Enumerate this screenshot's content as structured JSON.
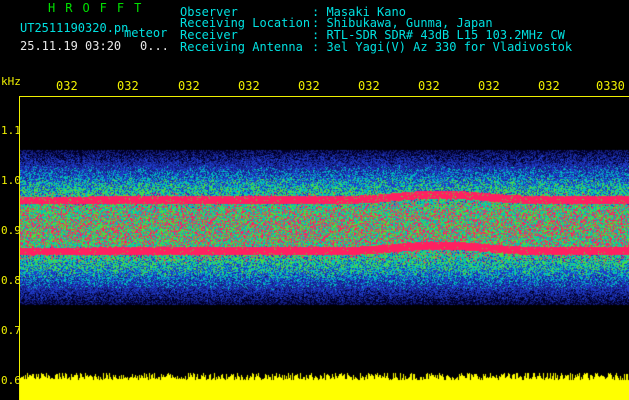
{
  "title": "HROFFT",
  "file": {
    "name": "UT2511190320.pn",
    "tag": "meteor",
    "datetime": "25.11.19 03:20",
    "extra": "0..."
  },
  "info": {
    "observer_label": "Observer",
    "observer_value": ": Masaki Kano",
    "location_label": "Receiving Location",
    "location_value": ": Shibukawa, Gunma, Japan",
    "receiver_label": "Receiver",
    "receiver_value": ": RTL-SDR SDR# 43dB L15 103.2MHz CW",
    "antenna_label": "Receiving Antenna",
    "antenna_value": ": 3el Yagi(V) Az 330 for Vladivostok"
  },
  "axis": {
    "unit": "kHz",
    "time_ticks": [
      "032",
      "032",
      "032",
      "032",
      "032",
      "032",
      "032",
      "032",
      "032",
      "0330"
    ],
    "freq_ticks": [
      "1.1",
      "1.0",
      "0.9",
      "0.8",
      "0.7",
      "0.6"
    ]
  },
  "colors": {
    "background": "#000000",
    "axis": "#f0f000",
    "header_info": "#00e0e0",
    "title": "#00e000",
    "noise_low": "#1e2aa0",
    "noise_mid": "#00c0c0",
    "noise_high": "#40e040",
    "signal": "#ff2060",
    "amplitude_bar": "#ffff00"
  }
}
